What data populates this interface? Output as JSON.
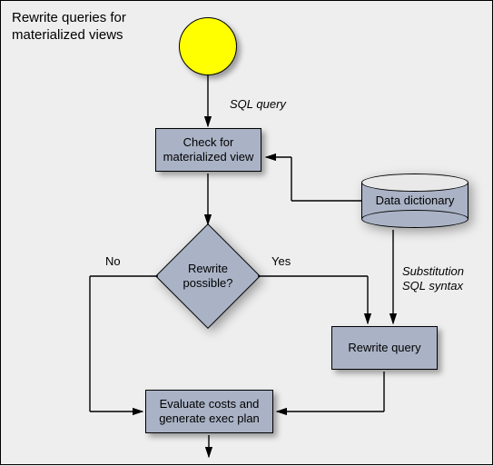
{
  "title_line1": "Rewrite queries for",
  "title_line2": "materialized views",
  "nodes": {
    "start": "",
    "check": "Check for\nmaterialized view",
    "decision": "Rewrite\npossible?",
    "dictionary": "Data dictionary",
    "rewrite": "Rewrite query",
    "evaluate": "Evaluate costs and\ngenerate exec plan"
  },
  "labels": {
    "sql_query": "SQL query",
    "no": "No",
    "yes": "Yes",
    "substitution_l1": "Substitution",
    "substitution_l2": "SQL syntax"
  },
  "chart_data": {
    "type": "flowchart",
    "title": "Rewrite queries for materialized views",
    "nodes": [
      {
        "id": "start",
        "type": "start",
        "label": ""
      },
      {
        "id": "check",
        "type": "process",
        "label": "Check for materialized view"
      },
      {
        "id": "decision",
        "type": "decision",
        "label": "Rewrite possible?"
      },
      {
        "id": "dictionary",
        "type": "datastore",
        "label": "Data dictionary"
      },
      {
        "id": "rewrite",
        "type": "process",
        "label": "Rewrite query"
      },
      {
        "id": "evaluate",
        "type": "process",
        "label": "Evaluate costs and generate exec plan"
      },
      {
        "id": "end",
        "type": "end",
        "label": ""
      }
    ],
    "edges": [
      {
        "from": "start",
        "to": "check",
        "label": "SQL query"
      },
      {
        "from": "check",
        "to": "decision",
        "label": ""
      },
      {
        "from": "dictionary",
        "to": "check",
        "label": ""
      },
      {
        "from": "dictionary",
        "to": "rewrite",
        "label": "Substitution SQL syntax"
      },
      {
        "from": "decision",
        "to": "rewrite",
        "label": "Yes"
      },
      {
        "from": "decision",
        "to": "evaluate",
        "label": "No"
      },
      {
        "from": "rewrite",
        "to": "evaluate",
        "label": ""
      },
      {
        "from": "evaluate",
        "to": "end",
        "label": ""
      }
    ]
  }
}
